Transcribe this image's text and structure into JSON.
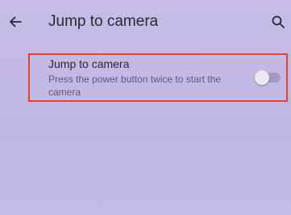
{
  "header": {
    "back_icon": "arrow-left-icon",
    "title": "Jump to camera",
    "search_icon": "search-icon"
  },
  "setting": {
    "title": "Jump to camera",
    "summary": "Press the power button twice to start the camera",
    "toggle_on": false
  },
  "colors": {
    "background": "#c2b8e4",
    "highlight_border": "#e8412a",
    "text_primary": "#2b2836",
    "text_secondary": "#5f5a74"
  }
}
